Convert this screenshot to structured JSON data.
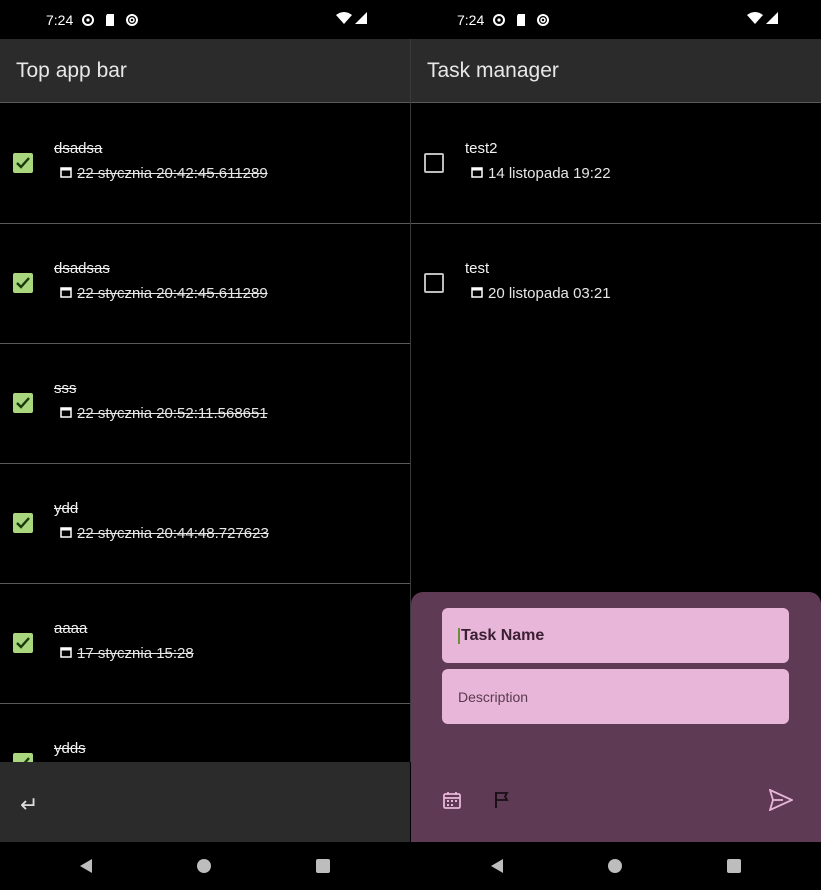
{
  "left": {
    "status": {
      "time": "7:24"
    },
    "app_bar": {
      "title": "Top app bar"
    },
    "tasks": [
      {
        "title": "dsadsa",
        "date": "22 stycznia  20:42:45.611289",
        "done": true
      },
      {
        "title": "dsadsas",
        "date": "22 stycznia  20:42:45.611289",
        "done": true
      },
      {
        "title": "sss",
        "date": "22 stycznia  20:52:11.568651",
        "done": true
      },
      {
        "title": "ydd",
        "date": "22 stycznia  20:44:48.727623",
        "done": true
      },
      {
        "title": "aaaa",
        "date": "17 stycznia  15:28",
        "done": true
      },
      {
        "title": "ydds",
        "date": "",
        "done": true
      }
    ],
    "bottom_bar": {
      "icon": "keyboard-return-icon"
    }
  },
  "right": {
    "status": {
      "time": "7:24"
    },
    "app_bar": {
      "title": "Task manager"
    },
    "tasks": [
      {
        "title": "test2",
        "date": "14 listopada 19:22",
        "done": false
      },
      {
        "title": "test",
        "date": "20 listopada 03:21",
        "done": false
      }
    ],
    "sheet": {
      "task_name_placeholder": "Task Name",
      "description_placeholder": "Description",
      "icons": [
        "calendar-icon",
        "flag-icon",
        "send-icon"
      ]
    }
  },
  "colors": {
    "checkbox_checked": "#a8d77e",
    "sheet_background": "#5f3a55",
    "field_background": "#e8b6d8",
    "app_bar_background": "#2b2b2b"
  }
}
